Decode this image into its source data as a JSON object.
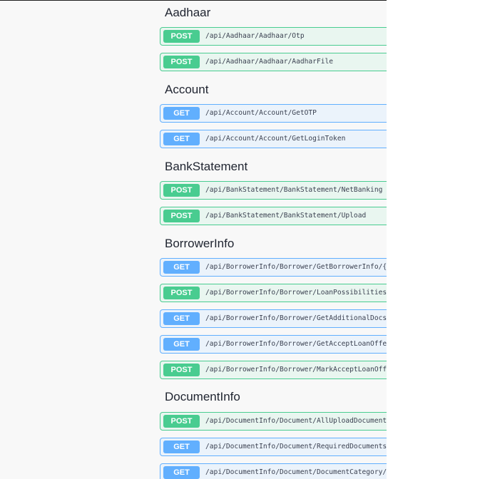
{
  "groups": [
    {
      "name": "Aadhaar",
      "operations": [
        {
          "method": "POST",
          "path": "/api/Aadhaar/Aadhaar/Otp"
        },
        {
          "method": "POST",
          "path": "/api/Aadhaar/Aadhaar/AadharFile"
        }
      ]
    },
    {
      "name": "Account",
      "operations": [
        {
          "method": "GET",
          "path": "/api/Account/Account/GetOTP"
        },
        {
          "method": "GET",
          "path": "/api/Account/Account/GetLoginToken"
        }
      ]
    },
    {
      "name": "BankStatement",
      "operations": [
        {
          "method": "POST",
          "path": "/api/BankStatement/BankStatement/NetBanking"
        },
        {
          "method": "POST",
          "path": "/api/BankStatement/BankStatement/Upload"
        }
      ]
    },
    {
      "name": "BorrowerInfo",
      "operations": [
        {
          "method": "GET",
          "path": "/api/BorrowerInfo/Borrower/GetBorrowerInfo/{"
        },
        {
          "method": "POST",
          "path": "/api/BorrowerInfo/Borrower/LoanPossibilities"
        },
        {
          "method": "GET",
          "path": "/api/BorrowerInfo/Borrower/GetAdditionalDocs"
        },
        {
          "method": "GET",
          "path": "/api/BorrowerInfo/Borrower/GetAcceptLoanOffer"
        },
        {
          "method": "POST",
          "path": "/api/BorrowerInfo/Borrower/MarkAcceptLoanOffer"
        }
      ]
    },
    {
      "name": "DocumentInfo",
      "operations": [
        {
          "method": "POST",
          "path": "/api/DocumentInfo/Document/AllUploadDocument"
        },
        {
          "method": "GET",
          "path": "/api/DocumentInfo/Document/RequiredDocuments"
        },
        {
          "method": "GET",
          "path": "/api/DocumentInfo/Document/DocumentCategory/"
        }
      ]
    }
  ]
}
